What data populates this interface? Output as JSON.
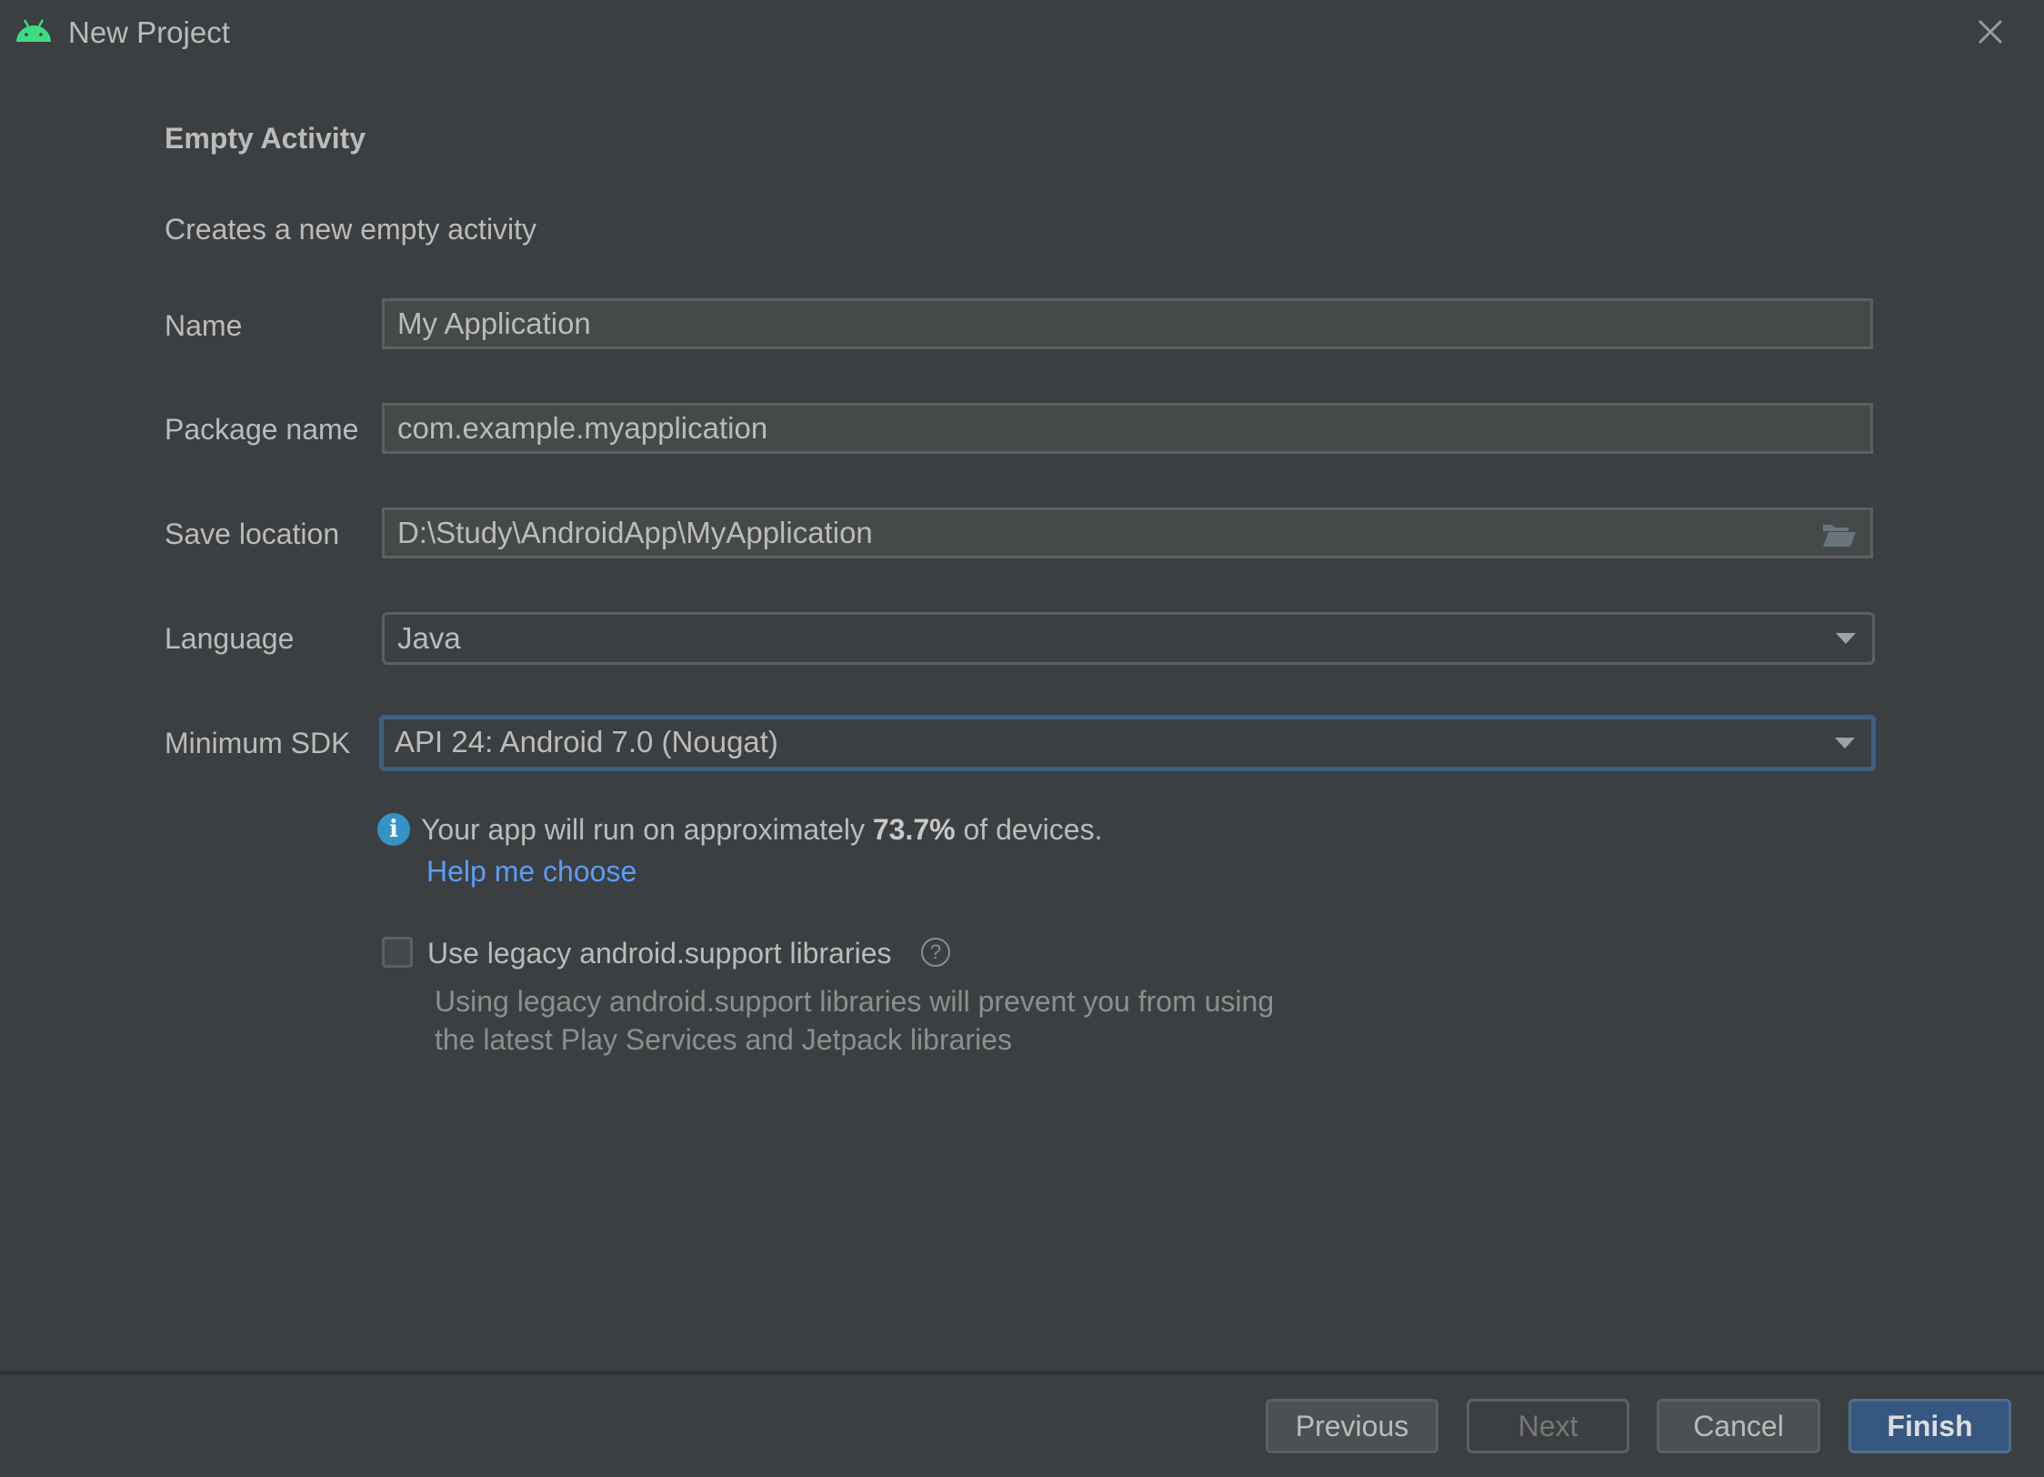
{
  "window": {
    "title": "New Project",
    "app_icon": "android-icon",
    "close_icon": "close-icon"
  },
  "template": {
    "heading": "Empty Activity",
    "description": "Creates a new empty activity"
  },
  "form": {
    "name": {
      "label": "Name",
      "value": "My Application"
    },
    "package_name": {
      "label": "Package name",
      "value": "com.example.myapplication"
    },
    "save_location": {
      "label": "Save location",
      "value": "D:\\Study\\AndroidApp\\MyApplication",
      "icon": "folder-open-icon"
    },
    "language": {
      "label": "Language",
      "value": "Java"
    },
    "minimum_sdk": {
      "label": "Minimum SDK",
      "value": "API 24: Android 7.0 (Nougat)"
    }
  },
  "info": {
    "prefix": "Your app will run on approximately ",
    "percent": "73.7%",
    "suffix": " of devices.",
    "link": "Help me choose",
    "icon": "info-icon"
  },
  "legacy": {
    "label": "Use legacy android.support libraries",
    "checked": false,
    "hint_line1": "Using legacy android.support libraries will prevent you from using",
    "hint_line2": "the latest Play Services and Jetpack libraries",
    "help_icon": "?"
  },
  "buttons": {
    "previous": "Previous",
    "next": "Next",
    "cancel": "Cancel",
    "finish": "Finish"
  },
  "colors": {
    "background": "#3c3f41",
    "text": "#bbbbbb",
    "accent": "#365880",
    "focus": "#3d6185",
    "link": "#589df6",
    "android_green": "#3ddc84"
  }
}
